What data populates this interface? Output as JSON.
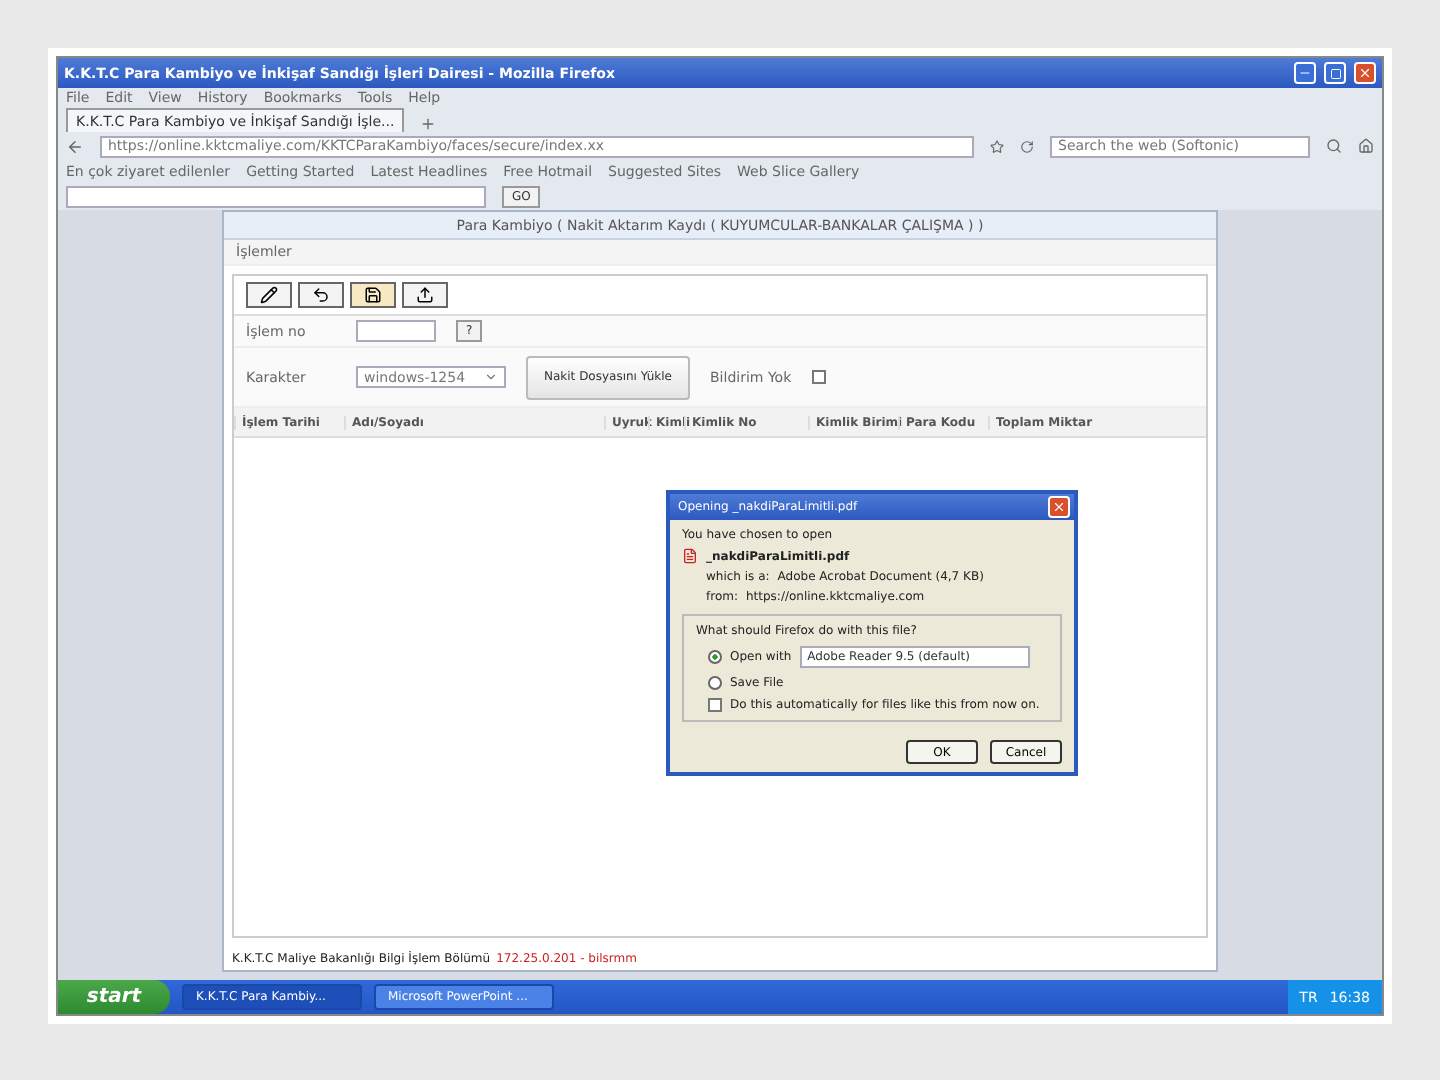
{
  "window": {
    "title": "K.K.T.C Para Kambiyo ve İnkişaf Sandığı İşleri Dairesi - Mozilla Firefox"
  },
  "menu": [
    "File",
    "Edit",
    "View",
    "History",
    "Bookmarks",
    "Tools",
    "Help"
  ],
  "tabs": [
    {
      "label": "K.K.T.C Para Kambiyo ve İnkişaf Sandığı İşle...",
      "selected": true
    }
  ],
  "address": {
    "url": "https://online.kktcmaliye.com/KKTCParaKambiyo/faces/secure/index.xx",
    "search_placeholder": "Search the web (Softonic)"
  },
  "bookmarks": [
    "En çok ziyaret edilenler",
    "Getting Started",
    "Latest Headlines",
    "Free Hotmail",
    "Suggested Sites",
    "Web Slice Gallery"
  ],
  "toolbar": {
    "go": "GO"
  },
  "app": {
    "header": "Para Kambiyo ( Nakit Aktarım Kaydı ( KUYUMCULAR-BANKALAR ÇALIŞMA ) )",
    "menu": "İşlemler",
    "tools": [
      {
        "kind": "edit",
        "selected": false
      },
      {
        "kind": "undo",
        "selected": false
      },
      {
        "kind": "save",
        "selected": true
      },
      {
        "kind": "upload",
        "selected": false
      }
    ],
    "islem_label": "İşlem no",
    "help_button": "?",
    "karakter_label": "Karakter",
    "karakter_value": "windows-1254",
    "load_button": "Nakit Dosyasını Yükle",
    "bildirim_label": "Bildirim Yok",
    "bildirim_checked": false,
    "columns": [
      "İşlem Tarihi",
      "Adı/Soyadı",
      "Uyruk",
      "Kimli",
      "Kimlik No",
      "Kimlik Birimi",
      "Para Kodu",
      "Toplam Miktar"
    ],
    "status": "K.K.T.C Maliye Bakanlığı Bilgi İşlem Bölümü",
    "status_server": "172.25.0.201 - bilsrmm"
  },
  "dialog": {
    "title": "Opening _nakdiParaLimitli.pdf",
    "intro": "You have chosen to open",
    "file": "_nakdiParaLimitli.pdf",
    "which_label": "which is a:",
    "which": "Adobe Acrobat Document (4,7 KB)",
    "from_label": "from:",
    "from": "https://online.kktcmaliye.com",
    "question": "What should Firefox do with this file?",
    "options": [
      {
        "label": "Open with",
        "selected": true
      },
      {
        "label": "Save File",
        "selected": false
      }
    ],
    "app": "Adobe Reader 9.5 (default)",
    "auto": "Do this automatically for files like this from now on.",
    "auto_checked": false,
    "buttons": [
      "OK",
      "Cancel"
    ]
  },
  "taskbar": {
    "start": "start",
    "items": [
      {
        "label": "K.K.T.C Para Kambiy...",
        "selected": false
      },
      {
        "label": "Microsoft PowerPoint ...",
        "selected": true
      }
    ],
    "lang": "TR",
    "clock": "16:38"
  }
}
